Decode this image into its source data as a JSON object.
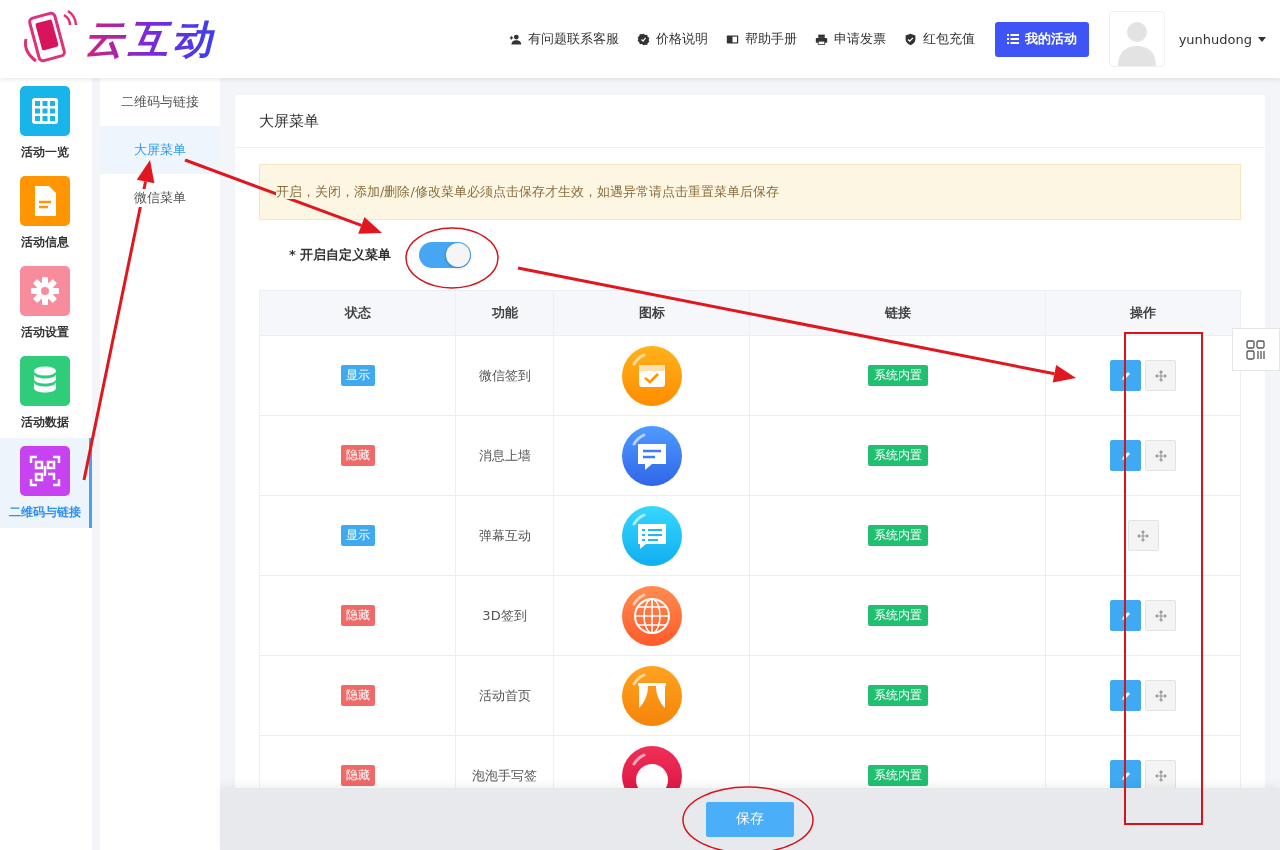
{
  "header": {
    "logo": "云互动",
    "nav": [
      {
        "label": "有问题联系客服",
        "kind": "user"
      },
      {
        "label": "价格说明",
        "kind": "badge"
      },
      {
        "label": "帮助手册",
        "kind": "book"
      },
      {
        "label": "申请发票",
        "kind": "printer"
      },
      {
        "label": "红包充值",
        "kind": "shield"
      }
    ],
    "primary_button": "我的活动",
    "user": "yunhudong"
  },
  "sidebar": {
    "items": [
      {
        "label": "活动一览",
        "kind": "grid",
        "color": "#19b4ea",
        "selected": false
      },
      {
        "label": "活动信息",
        "kind": "document",
        "color": "#ff9500",
        "selected": false
      },
      {
        "label": "活动设置",
        "kind": "gear",
        "color": "#f78c9c",
        "selected": false
      },
      {
        "label": "活动数据",
        "kind": "database",
        "color": "#2fcc7a",
        "selected": false
      },
      {
        "label": "二维码与链接",
        "kind": "qrcode",
        "color": "#c742f0",
        "selected": true
      }
    ]
  },
  "submenu": {
    "items": [
      {
        "label": "二维码与链接",
        "selected": false
      },
      {
        "label": "大屏菜单",
        "selected": true
      },
      {
        "label": "微信菜单",
        "selected": false
      }
    ]
  },
  "card": {
    "title": "大屏菜单",
    "notice": "开启，关闭，添加/删除/修改菜单必须点击保存才生效，如遇异常请点击重置菜单后保存",
    "toggle": {
      "label": "* 开启自定义菜单",
      "on": true
    }
  },
  "table": {
    "columns": [
      "状态",
      "功能",
      "图标",
      "链接",
      "操作"
    ],
    "rows": [
      {
        "status": "显示",
        "visible": true,
        "name": "微信签到",
        "kind": "calendar",
        "link": "系统内置",
        "editable": true
      },
      {
        "status": "隐藏",
        "visible": false,
        "name": "消息上墙",
        "kind": "chat",
        "link": "系统内置",
        "editable": true
      },
      {
        "status": "显示",
        "visible": true,
        "name": "弹幕互动",
        "kind": "danmu",
        "link": "系统内置",
        "editable": false
      },
      {
        "status": "隐藏",
        "visible": false,
        "name": "3D签到",
        "kind": "globe",
        "link": "系统内置",
        "editable": true
      },
      {
        "status": "隐藏",
        "visible": false,
        "name": "活动首页",
        "kind": "curtain",
        "link": "系统内置",
        "editable": true
      },
      {
        "status": "隐藏",
        "visible": false,
        "name": "泡泡手写签",
        "kind": "bubble",
        "link": "系统内置",
        "editable": true
      }
    ]
  },
  "save_button": "保存"
}
